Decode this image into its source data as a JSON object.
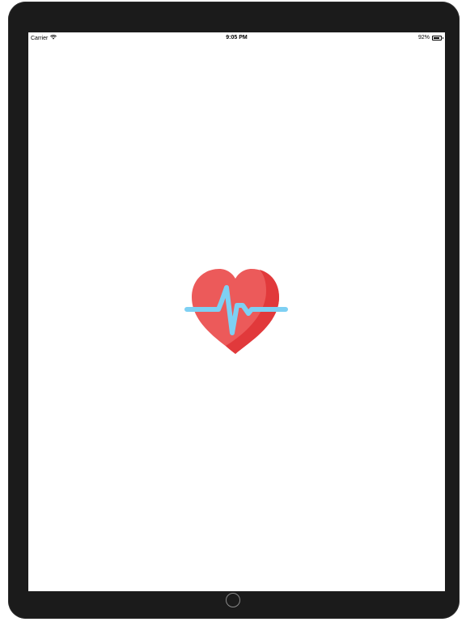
{
  "status_bar": {
    "carrier": "Carrier",
    "time": "9:05 PM",
    "battery_percent_label": "92%",
    "battery_level": 0.92,
    "wifi_icon": "wifi-icon",
    "battery_icon": "battery-icon"
  },
  "app": {
    "logo_icon": "heart-pulse-icon"
  },
  "colors": {
    "heart": "#ec5a5a",
    "heart_shade": "#e1393b",
    "pulse": "#7ed0f3",
    "device_frame": "#1b1b1b"
  }
}
